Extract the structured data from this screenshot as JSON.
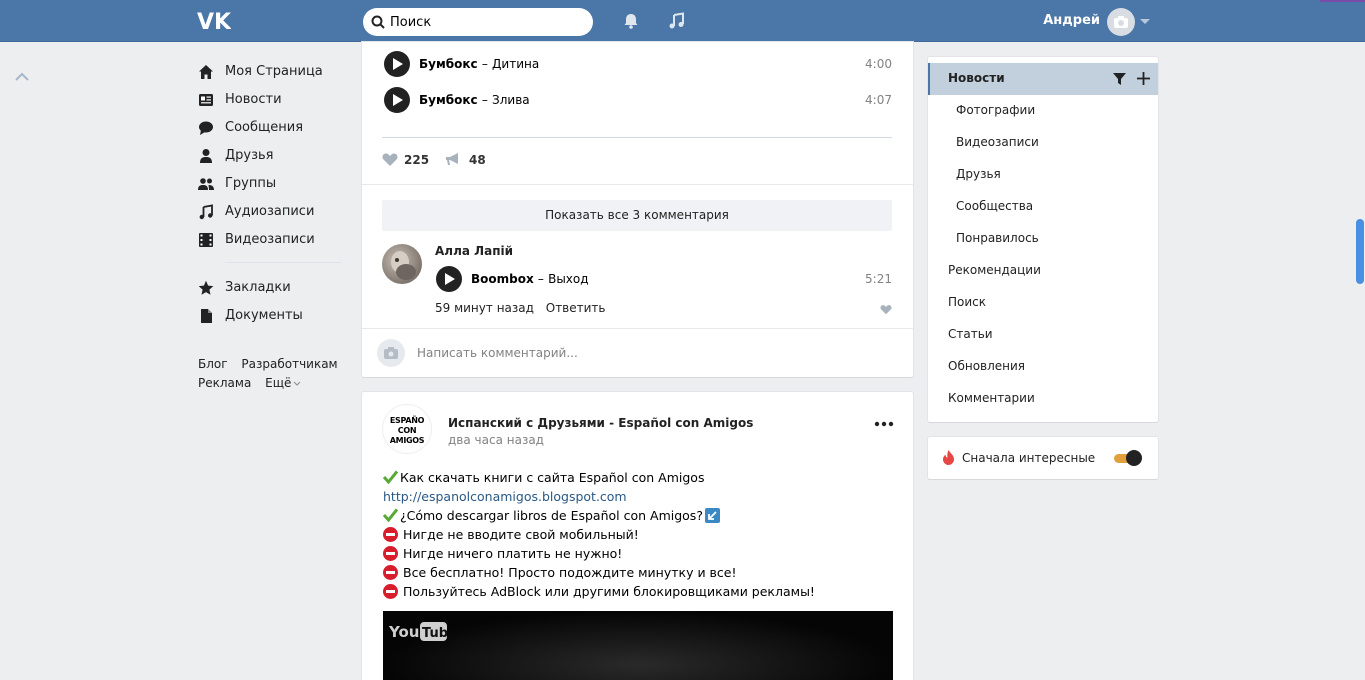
{
  "header": {
    "logo": "vk-logo",
    "search_placeholder": "Поиск",
    "user_name": "Андрей"
  },
  "left_nav": {
    "items": [
      {
        "label": "Моя Страница",
        "icon": "home-icon"
      },
      {
        "label": "Новости",
        "icon": "news-icon"
      },
      {
        "label": "Сообщения",
        "icon": "messages-icon"
      },
      {
        "label": "Друзья",
        "icon": "friends-icon"
      },
      {
        "label": "Группы",
        "icon": "groups-icon"
      },
      {
        "label": "Аудиозаписи",
        "icon": "music-icon"
      },
      {
        "label": "Видеозаписи",
        "icon": "video-icon"
      }
    ],
    "items2": [
      {
        "label": "Закладки",
        "icon": "star-icon"
      },
      {
        "label": "Документы",
        "icon": "document-icon"
      }
    ],
    "footer": {
      "blog": "Блог",
      "developers": "Разработчикам",
      "ads": "Реклама",
      "more": "Ещё"
    }
  },
  "post1": {
    "tracks": [
      {
        "artist": "Бумбокс",
        "dash": "–",
        "title": "Дитина",
        "duration": "4:00"
      },
      {
        "artist": "Бумбокс",
        "dash": "–",
        "title": "Злива",
        "duration": "4:07"
      }
    ],
    "likes": "225",
    "shares": "48",
    "show_comments": "Показать все 3 комментария",
    "comment": {
      "author": "Алла Лапій",
      "track_artist": "Boombox",
      "dash": "–",
      "track_title": "Выход",
      "track_duration": "5:21",
      "time": "59 минут назад",
      "reply": "Ответить"
    },
    "write_placeholder": "Написать комментарий..."
  },
  "post2": {
    "avatar_text": "ESPAÑO CON AMIGOS",
    "author": "Испанский с Друзьями - Español con Amigos",
    "time": "два часа назад",
    "lines": [
      "Как скачать книги с сайта Español con Amigos",
      "http://espanolconamigos.blogspot.com",
      "¿Cómo descargar libros de Español con Amigos?",
      "Нигде не вводите свой мобильный!",
      "Нигде ничего платить не нужно!",
      "Все бесплатно! Просто подождите минутку и все!",
      "Пользуйтесь AdBlock или другими блокировщиками рекламы!"
    ],
    "video_logo": "YouTube"
  },
  "right_menu": {
    "items": [
      "Новости",
      "Фотографии",
      "Видеозаписи",
      "Друзья",
      "Сообщества",
      "Понравилось",
      "Рекомендации",
      "Поиск",
      "Статьи",
      "Обновления",
      "Комментарии"
    ],
    "active": "Новости"
  },
  "toggle": {
    "label": "Сначала интересные",
    "on": true
  },
  "colors": {
    "header_bg": "#4a76a8",
    "page_bg": "#edeef0",
    "link": "#2a5885",
    "active_menu": "#c2d0de",
    "toggle_track": "#e2a03c"
  }
}
